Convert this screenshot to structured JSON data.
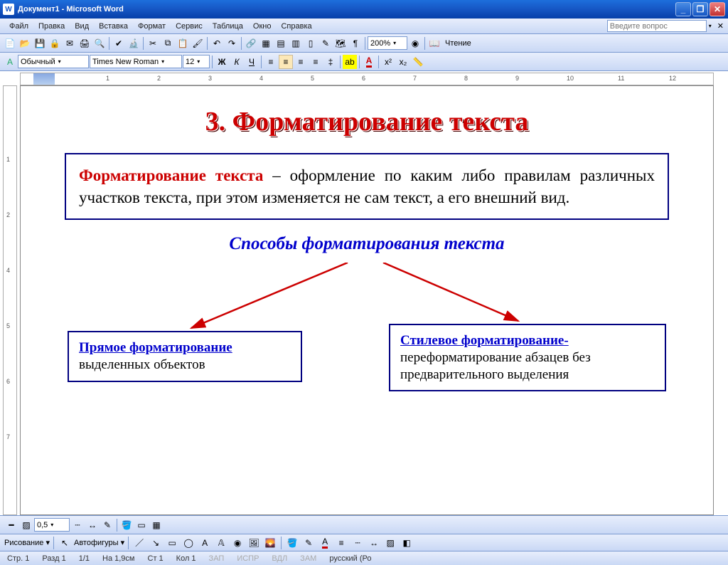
{
  "title_bar": {
    "doc_name": "Документ1",
    "app_name": "Microsoft Word"
  },
  "win_buttons": {
    "min": "_",
    "max": "❐",
    "close": "✕"
  },
  "menu": {
    "items": [
      "Файл",
      "Правка",
      "Вид",
      "Вставка",
      "Формат",
      "Сервис",
      "Таблица",
      "Окно",
      "Справка"
    ],
    "question_placeholder": "Введите вопрос"
  },
  "toolbar1": {
    "zoom": "200%",
    "reading": "Чтение"
  },
  "format_bar": {
    "style": "Обычный",
    "font": "Times New Roman",
    "size": "12",
    "bold": "Ж",
    "italic": "К",
    "underline": "Ч"
  },
  "ruler_h": {
    "nums": [
      "",
      "1",
      "2",
      "3",
      "4",
      "5",
      "6",
      "7",
      "8",
      "9",
      "10",
      "11",
      "12"
    ]
  },
  "ruler_v": {
    "nums": [
      "",
      "1",
      "2",
      "4",
      "5",
      "6",
      "7"
    ]
  },
  "doc": {
    "heading": "3. Форматирование текста",
    "def_term": "Форматирование текста",
    "def_rest": " – оформление по каким либо правилам различных участков текста, при этом изменяется не сам текст, а его внешний вид.",
    "subhead": "Способы форматирования текста",
    "left_title": "Прямое форматирование",
    "left_rest": " выделенных объектов",
    "right_title": "Стилевое форматирование-",
    "right_rest": " переформатирование абзацев без предварительного выделения"
  },
  "toolbar_shape": {
    "weight": "0,5"
  },
  "drawing": {
    "label": "Рисование",
    "autoshapes": "Автофигуры"
  },
  "status": {
    "page": "Стр. 1",
    "section": "Разд 1",
    "pages": "1/1",
    "pos": "На 1,9см",
    "line": "Ст 1",
    "col": "Кол 1",
    "rec": "ЗАП",
    "trk": "ИСПР",
    "ext": "ВДЛ",
    "ovr": "ЗАМ",
    "lang": "русский (Ро"
  },
  "colors": {
    "accent_red": "#c00",
    "accent_blue": "#0000cc",
    "box_border": "#000080"
  }
}
